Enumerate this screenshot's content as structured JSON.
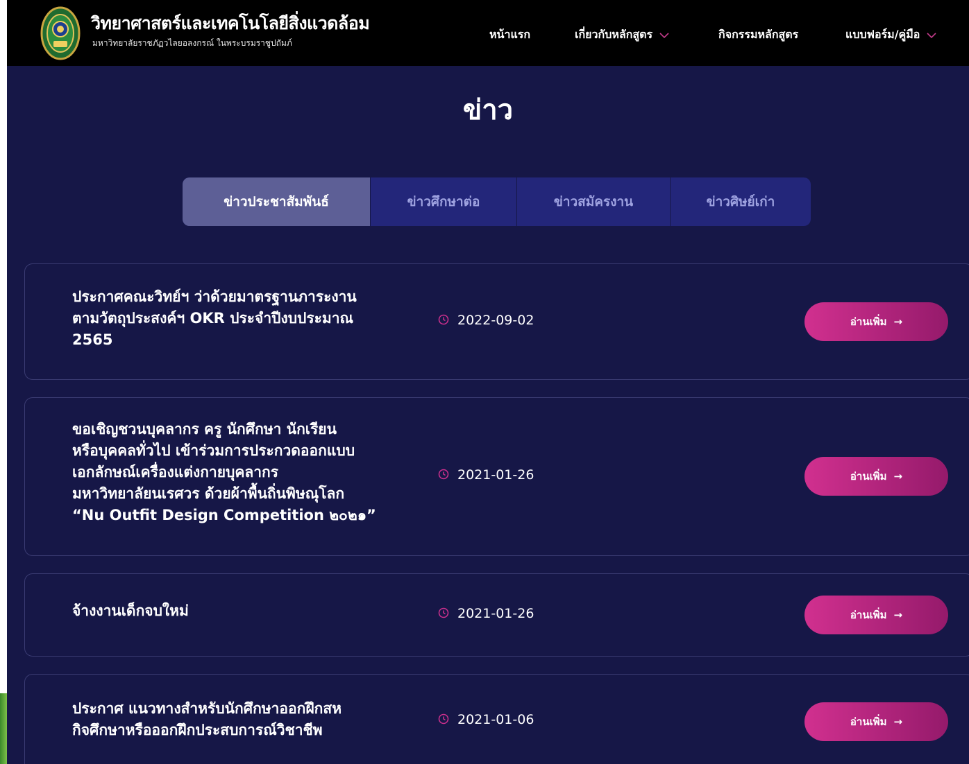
{
  "header": {
    "brand_title": "วิทยาศาสตร์และเทคโนโลยีสิ่งแวดล้อม",
    "brand_subtitle": "มหาวิทยาลัยราชภัฏวไลยอลงกรณ์ ในพระบรมราชูปถัมภ์",
    "nav": [
      {
        "label": "หน้าแรก",
        "has_dropdown": false
      },
      {
        "label": "เกี่ยวกับหลักสูตร",
        "has_dropdown": true
      },
      {
        "label": "กิจกรรมหลักสูตร",
        "has_dropdown": false
      },
      {
        "label": "แบบฟอร์ม/คู่มือ",
        "has_dropdown": true
      }
    ]
  },
  "page_title": "ข่าว",
  "tabs": [
    {
      "label": "ข่าวประชาสัมพันธ์",
      "active": true
    },
    {
      "label": "ข่าวศึกษาต่อ",
      "active": false
    },
    {
      "label": "ข่าวสมัครงาน",
      "active": false
    },
    {
      "label": "ข่าวศิษย์เก่า",
      "active": false
    }
  ],
  "news": [
    {
      "title_lines": [
        "ประกาศคณะวิทย์ฯ ว่าด้วยมาตรฐานภาระงาน",
        "ตามวัตถุประสงค์ฯ OKR ประจำปีงบประมาณ",
        "2565"
      ],
      "date": "2022-09-02",
      "button_label": "อ่านเพิ่ม",
      "button_arrow": "→"
    },
    {
      "title_lines": [
        "ขอเชิญชวนบุคลากร ครู นักศึกษา นักเรียน",
        "หรือบุคคลทั่วไป เข้าร่วมการประกวดออกแบบ",
        "เอกลักษณ์เครื่องแต่งกายบุคลากร",
        "มหาวิทยาลัยนเรศวร ด้วยผ้าพื้นถิ่นพิษณุโลก",
        "“Nu Outfit Design Competition ๒๐๒๑”"
      ],
      "date": "2021-01-26",
      "button_label": "อ่านเพิ่ม",
      "button_arrow": "→"
    },
    {
      "title_lines": [
        "จ้างงานเด็กจบใหม่"
      ],
      "date": "2021-01-26",
      "button_label": "อ่านเพิ่ม",
      "button_arrow": "→"
    },
    {
      "title_lines": [
        "ประกาศ แนวทางสำหรับนักศึกษาออกฝึกสห",
        "กิจศึกษาหรือออกฝึกประสบการณ์วิชาชีพ"
      ],
      "date": "2021-01-06",
      "button_label": "อ่านเพิ่ม",
      "button_arrow": "→"
    }
  ],
  "colors": {
    "page_bg": "#161747",
    "header_bg": "#000000",
    "tab_bg": "#23267a",
    "tab_active_bg": "#5d5f96",
    "accent_pink": "#d1308f",
    "accent_dark_pink": "#951a6b"
  }
}
